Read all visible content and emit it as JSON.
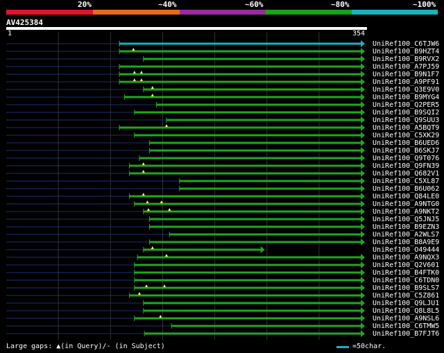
{
  "scale": {
    "labels": [
      "20%",
      "~40%",
      "~60%",
      "~80%",
      "~100%"
    ],
    "colors": [
      "#e8112d",
      "#e86a1a",
      "#9c2aa0",
      "#17a317",
      "#17b3c0"
    ]
  },
  "query": {
    "id": "AV425384",
    "start": "1",
    "end": "354",
    "length": 354
  },
  "colors": {
    "hit": "#1fa81f",
    "top_hit": "#17b3c0",
    "gap": "#1e2e6e",
    "grid": "#333333",
    "marker": "#ffff66"
  },
  "rows": [
    {
      "label": "UniRef100_C6TJW6",
      "start": 113,
      "end": 354,
      "top": true,
      "marks": []
    },
    {
      "label": "UniRef100_B9HZT4",
      "start": 113,
      "end": 354,
      "marks": [
        127
      ]
    },
    {
      "label": "UniRef100_B9RVX2",
      "start": 137,
      "end": 354,
      "marks": []
    },
    {
      "label": "UniRef100_A7PJ59",
      "start": 113,
      "end": 354,
      "marks": []
    },
    {
      "label": "UniRef100_B9N1F7",
      "start": 113,
      "end": 354,
      "marks": [
        128,
        135
      ]
    },
    {
      "label": "UniRef100_A9PF91",
      "start": 113,
      "end": 354,
      "marks": [
        128,
        135
      ]
    },
    {
      "label": "UniRef100_Q3E9V0",
      "start": 137,
      "end": 354,
      "marks": [
        146
      ]
    },
    {
      "label": "UniRef100_B9MYG4",
      "start": 118,
      "end": 354,
      "marks": [
        146
      ]
    },
    {
      "label": "UniRef100_Q2PER5",
      "start": 150,
      "end": 354,
      "marks": []
    },
    {
      "label": "UniRef100_B9SQI2",
      "start": 128,
      "end": 354,
      "marks": []
    },
    {
      "label": "UniRef100_Q9SUU3",
      "start": 160,
      "end": 354,
      "marks": []
    },
    {
      "label": "UniRef100_A5BQT9",
      "start": 113,
      "end": 354,
      "marks": [
        160
      ]
    },
    {
      "label": "UniRef100_C5XK29",
      "start": 128,
      "end": 354,
      "marks": []
    },
    {
      "label": "UniRef100_B6UED6",
      "start": 143,
      "end": 354,
      "marks": []
    },
    {
      "label": "UniRef100_B6SKJ7",
      "start": 143,
      "end": 354,
      "marks": []
    },
    {
      "label": "UniRef100_Q9T076",
      "start": 133,
      "end": 354,
      "marks": []
    },
    {
      "label": "UniRef100_Q9FN39",
      "start": 123,
      "end": 354,
      "marks": [
        137
      ]
    },
    {
      "label": "UniRef100_Q682V1",
      "start": 123,
      "end": 354,
      "marks": [
        137
      ]
    },
    {
      "label": "UniRef100_C5XL87",
      "start": 173,
      "end": 354,
      "marks": []
    },
    {
      "label": "UniRef100_B6U062",
      "start": 173,
      "end": 354,
      "marks": []
    },
    {
      "label": "UniRef100_Q84LE0",
      "start": 123,
      "end": 354,
      "marks": [
        137
      ]
    },
    {
      "label": "UniRef100_A9NTG0",
      "start": 128,
      "end": 354,
      "marks": [
        141,
        155
      ]
    },
    {
      "label": "UniRef100_A9NKT2",
      "start": 137,
      "end": 354,
      "marks": [
        142,
        163
      ]
    },
    {
      "label": "UniRef100_Q5JNJ5",
      "start": 143,
      "end": 354,
      "marks": []
    },
    {
      "label": "UniRef100_B9EZN3",
      "start": 143,
      "end": 354,
      "marks": []
    },
    {
      "label": "UniRef100_A2WLS7",
      "start": 163,
      "end": 354,
      "marks": []
    },
    {
      "label": "UniRef100_B8A9E9",
      "start": 143,
      "end": 354,
      "marks": []
    },
    {
      "label": "UniRef100_O49444",
      "start": 137,
      "end": 254,
      "marks": [
        146
      ]
    },
    {
      "label": "UniRef100_A9NQX3",
      "start": 131,
      "end": 354,
      "marks": [
        160
      ]
    },
    {
      "label": "UniRef100_Q2V601",
      "start": 128,
      "end": 354,
      "marks": []
    },
    {
      "label": "UniRef100_B4FTK0",
      "start": 128,
      "end": 354,
      "marks": []
    },
    {
      "label": "UniRef100_C6TDN0",
      "start": 128,
      "end": 354,
      "marks": []
    },
    {
      "label": "UniRef100_B9SLS7",
      "start": 128,
      "end": 354,
      "marks": [
        140,
        158
      ]
    },
    {
      "label": "UniRef100_C5Z861",
      "start": 123,
      "end": 354,
      "marks": [
        133
      ]
    },
    {
      "label": "UniRef100_Q9LJU1",
      "start": 137,
      "end": 354,
      "marks": []
    },
    {
      "label": "UniRef100_Q8L8L5",
      "start": 137,
      "end": 354,
      "marks": []
    },
    {
      "label": "UniRef100_A9NSL6",
      "start": 128,
      "end": 354,
      "marks": [
        154
      ]
    },
    {
      "label": "UniRef100_C6TMW5",
      "start": 165,
      "end": 354,
      "marks": []
    },
    {
      "label": "UniRef100_B7FJT6",
      "start": 138,
      "end": 354,
      "marks": []
    }
  ],
  "footer": {
    "left": "Large gaps: ▲(in Query)/- (in Subject)",
    "right": "=50char."
  }
}
